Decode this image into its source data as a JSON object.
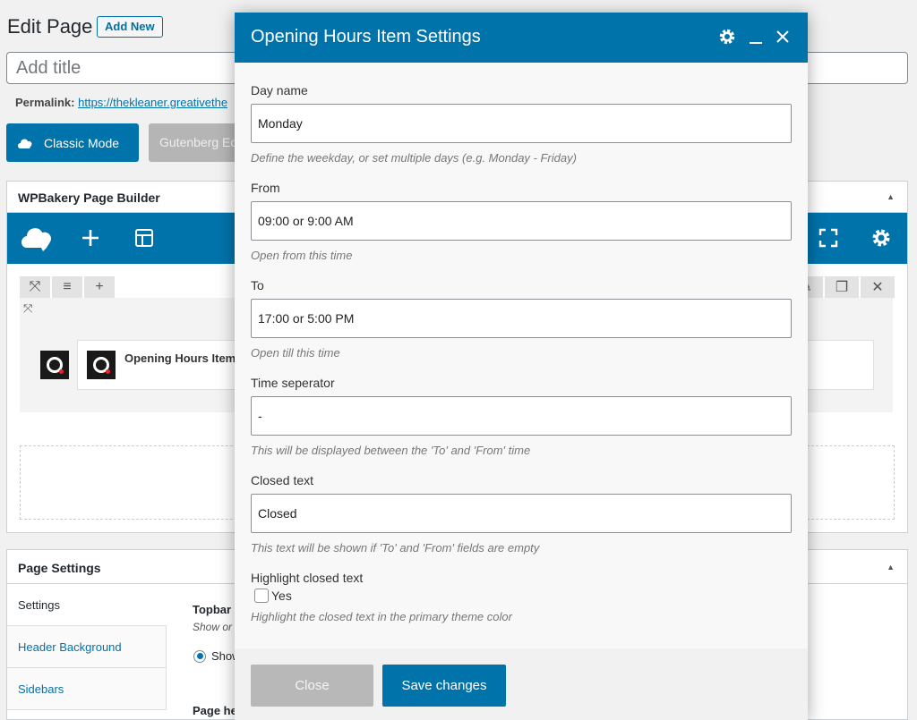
{
  "editor": {
    "page_title": "Edit Page",
    "add_new": "Add New",
    "title_placeholder": "Add title",
    "permalink_label": "Permalink:",
    "permalink_url": "https://thekleaner.greativethe",
    "classic_mode": "Classic Mode",
    "gutenberg": "Gutenberg Editor"
  },
  "wpbakery": {
    "title": "WPBakery Page Builder",
    "element_label": "Opening Hours Item"
  },
  "page_settings": {
    "title": "Page Settings",
    "tabs": [
      "Settings",
      "Header Background",
      "Sidebars"
    ],
    "topbar_label": "Topbar",
    "topbar_desc": "Show or",
    "radio_label": "Show",
    "page_header_label": "Page he"
  },
  "modal": {
    "title": "Opening Hours Item Settings",
    "fields": [
      {
        "label": "Day name",
        "value": "Monday",
        "desc": "Define the weekday, or set multiple days (e.g. Monday - Friday)"
      },
      {
        "label": "From",
        "value": "09:00 or 9:00 AM",
        "desc": "Open from this time"
      },
      {
        "label": "To",
        "value": "17:00 or 5:00 PM",
        "desc": "Open till this time"
      },
      {
        "label": "Time seperator",
        "value": "-",
        "desc": "This will be displayed between the 'To' and 'From' time"
      },
      {
        "label": "Closed text",
        "value": "Closed",
        "desc": "This text will be shown if 'To' and 'From' fields are empty"
      }
    ],
    "highlight": {
      "label": "Highlight closed text",
      "checkbox_label": "Yes",
      "desc": "Highlight the closed text in the primary theme color"
    },
    "close_button": "Close",
    "save_button": "Save changes"
  },
  "colors": {
    "accent": "#0073aa",
    "disabled": "#b8b8b8"
  }
}
